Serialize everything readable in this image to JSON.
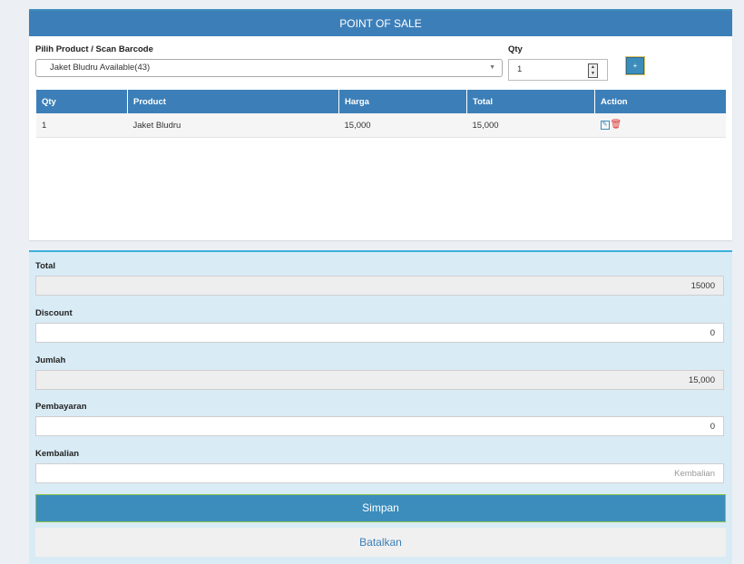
{
  "header": {
    "title": "POINT OF SALE"
  },
  "form": {
    "product_label": "Pilih Product / Scan Barcode",
    "product_selected": "Jaket Bludru Available(43)",
    "qty_label": "Qty",
    "qty_value": "1",
    "add_label": "+"
  },
  "table": {
    "columns": [
      "Qty",
      "Product",
      "Harga",
      "Total",
      "Action"
    ],
    "rows": [
      {
        "qty": "1",
        "product": "Jaket Bludru",
        "harga": "15,000",
        "total": "15,000"
      }
    ]
  },
  "payment": {
    "total_label": "Total",
    "total_value": "15000",
    "discount_label": "Discount",
    "discount_value": "0",
    "jumlah_label": "Jumlah",
    "jumlah_value": "15,000",
    "pembayaran_label": "Pembayaran",
    "pembayaran_value": "0",
    "kembalian_label": "Kembalian",
    "kembalian_placeholder": "Kembalian"
  },
  "buttons": {
    "save": "Simpan",
    "cancel": "Batalkan"
  },
  "icons": {
    "edit": "edit-icon",
    "delete": "trash-icon",
    "dropdown": "chevron-down-icon"
  },
  "colors": {
    "primary": "#3c8dbc",
    "delete": "#dd3333",
    "panel": "#d9ebf5"
  }
}
